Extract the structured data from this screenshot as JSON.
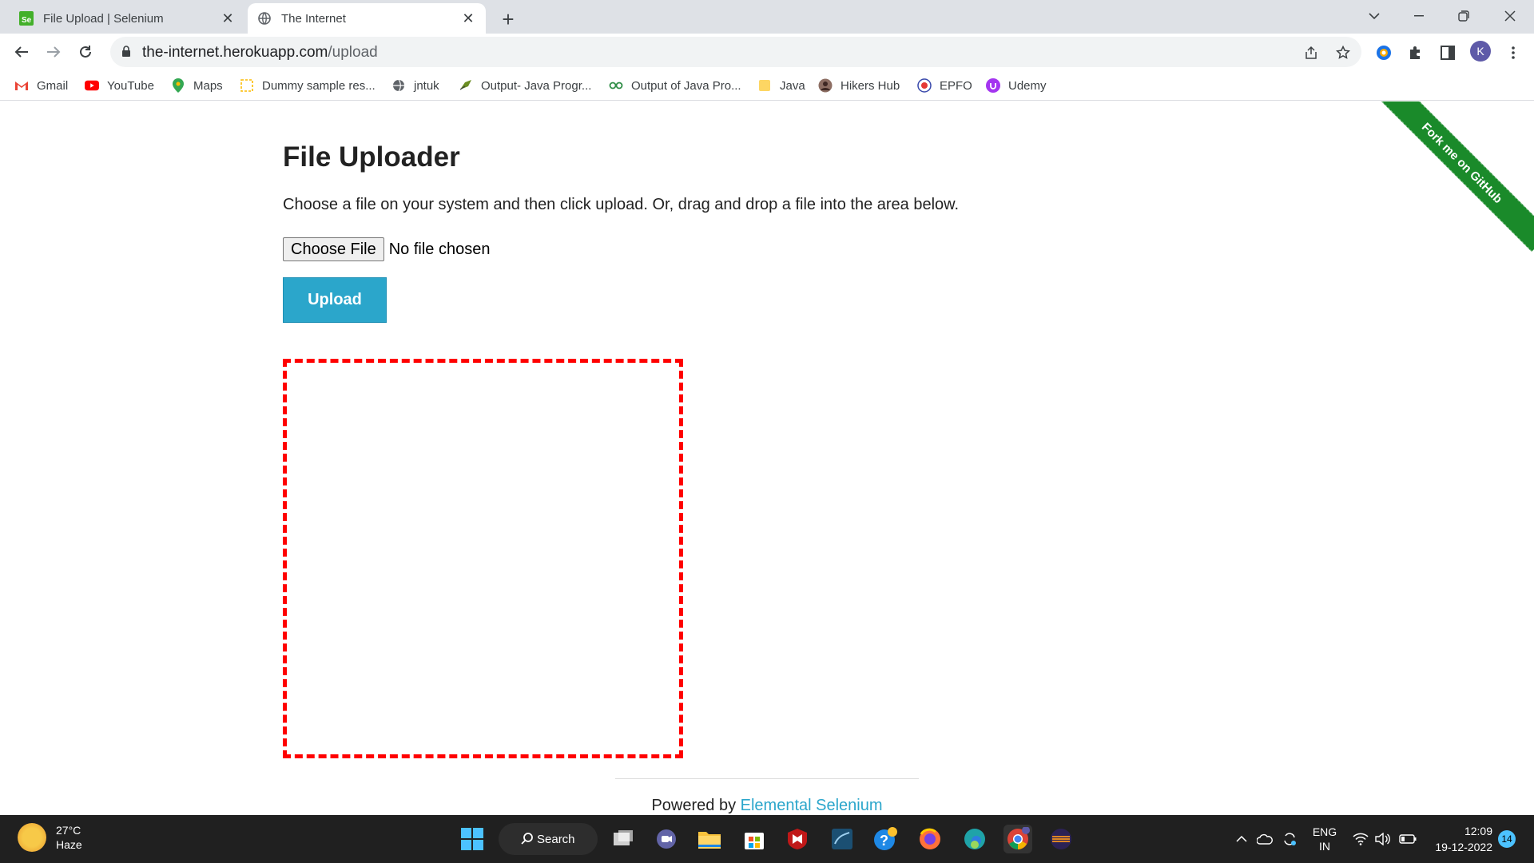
{
  "browser": {
    "tabs": [
      {
        "title": "File Upload | Selenium",
        "active": false,
        "icon": "selenium-icon"
      },
      {
        "title": "The Internet",
        "active": true,
        "icon": "globe-icon"
      }
    ],
    "url_host": "the-internet.herokuapp.com",
    "url_path": "/upload",
    "profile_initial": "K",
    "bookmarks": [
      {
        "label": "Gmail",
        "icon": "gmail-icon"
      },
      {
        "label": "YouTube",
        "icon": "youtube-icon"
      },
      {
        "label": "Maps",
        "icon": "maps-icon"
      },
      {
        "label": "Dummy sample res...",
        "icon": "page-icon"
      },
      {
        "label": "jntuk",
        "icon": "globe-icon"
      },
      {
        "label": "Output- Java Progr...",
        "icon": "bird-icon"
      },
      {
        "label": "Output of Java Pro...",
        "icon": "geeks-icon"
      },
      {
        "label": "Java",
        "icon": "folder-icon"
      },
      {
        "label": "Hikers Hub",
        "icon": "person-icon"
      },
      {
        "label": "EPFO",
        "icon": "emblem-icon"
      },
      {
        "label": "Udemy",
        "icon": "udemy-icon"
      }
    ]
  },
  "page": {
    "title": "File Uploader",
    "instructions": "Choose a file on your system and then click upload. Or, drag and drop a file into the area below.",
    "choose_file_label": "Choose File",
    "file_status": "No file chosen",
    "upload_label": "Upload",
    "ribbon_text": "Fork me on GitHub",
    "footer_prefix": "Powered by ",
    "footer_link": "Elemental Selenium",
    "colors": {
      "accent": "#2ba6cb",
      "dropzone_border": "#ff0000",
      "ribbon": "#1a8a2a"
    }
  },
  "taskbar": {
    "temperature": "27°C",
    "condition": "Haze",
    "search_label": "Search",
    "language": "ENG",
    "region": "IN",
    "time": "12:09",
    "date": "19-12-2022",
    "notification_count": "14"
  }
}
